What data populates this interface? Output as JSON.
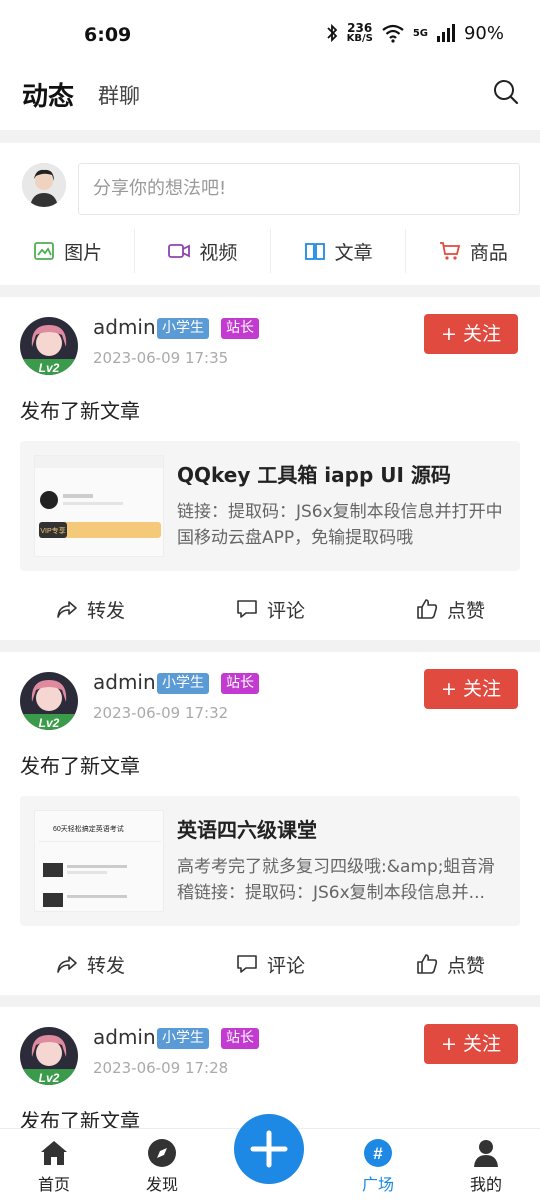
{
  "status_bar": {
    "time": "6:09",
    "speed_value": "236",
    "speed_unit": "KB/S",
    "network": "5G",
    "battery": "90%"
  },
  "header": {
    "tab_active": "动态",
    "tab_inactive": "群聊",
    "search_icon": "search-icon"
  },
  "composer": {
    "placeholder": "分享你的想法吧!",
    "actions": [
      {
        "label": "图片",
        "icon": "image-icon",
        "color": "#4caf50"
      },
      {
        "label": "视频",
        "icon": "video-icon",
        "color": "#8e44ad"
      },
      {
        "label": "文章",
        "icon": "book-icon",
        "color": "#1e88e5"
      },
      {
        "label": "商品",
        "icon": "cart-icon",
        "color": "#e04a3f"
      }
    ]
  },
  "posts": [
    {
      "author": "admin",
      "badges": [
        "小学生",
        "站长"
      ],
      "time": "2023-06-09 17:35",
      "follow": "+ 关注",
      "text": "发布了新文章",
      "article_title": "QQkey 工具箱 iapp UI 源码",
      "article_desc": "链接：提取码：JS6x复制本段信息并打开中国移动云盘APP，免输提取码哦",
      "thumb_label": "VIP专享"
    },
    {
      "author": "admin",
      "badges": [
        "小学生",
        "站长"
      ],
      "time": "2023-06-09 17:32",
      "follow": "+ 关注",
      "text": "发布了新文章",
      "article_title": "英语四六级课堂",
      "article_desc": "高考考完了就多复习四级哦:&amp;蛆音滑稽链接：提取码：JS6x复制本段信息并...",
      "thumb_label": "60天轻松搞定英语考试"
    },
    {
      "author": "admin",
      "badges": [
        "小学生",
        "站长"
      ],
      "time": "2023-06-09 17:28",
      "follow": "+ 关注",
      "text": "发布了新文章"
    }
  ],
  "post_actions": {
    "repost": "转发",
    "comment": "评论",
    "like": "点赞"
  },
  "bottom_nav": [
    {
      "label": "首页",
      "icon": "home-icon"
    },
    {
      "label": "发现",
      "icon": "compass-icon"
    },
    {
      "label": "广场",
      "icon": "hashtag-icon",
      "active": true
    },
    {
      "label": "我的",
      "icon": "user-icon"
    }
  ],
  "colors": {
    "accent": "#1e88e5",
    "follow": "#e04a3f",
    "badge_student": "#5b9bd5",
    "badge_admin": "#c23ad0"
  }
}
